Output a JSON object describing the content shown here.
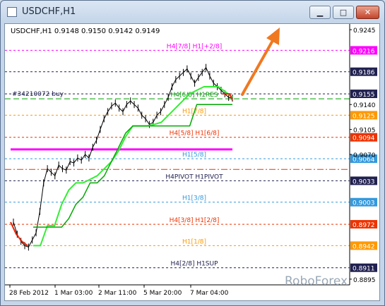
{
  "window": {
    "title": "USDCHF,H1",
    "min_icon": "minimize-icon",
    "max_icon": "maximize-icon",
    "close_icon": "close-icon",
    "min_label": "▁",
    "max_label": "□",
    "close_label": "✕"
  },
  "chart_info": {
    "header": "USDCHF,H1  0.9148 0.9150 0.9142 0.9149",
    "order_label": "#34210072 buy",
    "watermark": "RoboForex"
  },
  "chart_data": {
    "type": "line",
    "symbol": "USDCHF",
    "timeframe": "H1",
    "ylim": [
      0.8887,
      0.9253
    ],
    "x_ticks": [
      "28 Feb 2012",
      "1 Mar 03:00",
      "2 Mar 11:00",
      "5 Mar 20:00",
      "7 Mar 04:00"
    ],
    "y_ticks": [
      "0.9245",
      "0.9186",
      "0.9140",
      "0.9105",
      "0.9070",
      "0.9033",
      "0.8972",
      "0.8942",
      "0.8911",
      "0.8895"
    ],
    "levels": [
      {
        "label": "H4[7/8] H1[+2/8]",
        "value": 0.9216,
        "color": "#ff00ff",
        "dash": "3,3",
        "price": "0.9216"
      },
      {
        "label": "",
        "value": 0.9186,
        "color": "#202050",
        "dash": "3,3",
        "price": "0.9186"
      },
      {
        "label": "",
        "value": 0.9155,
        "color": "#202050",
        "dash": "3,3",
        "price": "0.9155"
      },
      {
        "label": "H4[6/8] H1RES",
        "value": 0.9148,
        "color": "#00a000",
        "dash": "8,4",
        "price": ""
      },
      {
        "label": "H1[7/8]",
        "value": 0.9125,
        "color": "#ff9900",
        "dash": "3,3",
        "price": "0.9125"
      },
      {
        "label": "H4[5/8] H1[6/8]",
        "value": 0.9094,
        "color": "#ee3300",
        "dash": "3,3",
        "price": "0.9094"
      },
      {
        "label": "H1[5/8]",
        "value": 0.9064,
        "color": "#3399dd",
        "dash": "3,3",
        "price": "0.9064"
      },
      {
        "label": "",
        "value": 0.9049,
        "color": "#ee3300",
        "dash": "9,3,2,3",
        "price": ""
      },
      {
        "label": "H4PIVOT H1PIVOT",
        "value": 0.9033,
        "color": "#202050",
        "dash": "3,3",
        "price": "0.9033"
      },
      {
        "label": "H1[3/8]",
        "value": 0.9003,
        "color": "#3399dd",
        "dash": "3,3",
        "price": "0.9003"
      },
      {
        "label": "H4[3/8] H1[2/8]",
        "value": 0.8972,
        "color": "#ee3300",
        "dash": "3,3",
        "price": "0.8972"
      },
      {
        "label": "H1[1/8]",
        "value": 0.8942,
        "color": "#ff9900",
        "dash": "3,3",
        "price": "0.8942"
      },
      {
        "label": "H4[2/8] H1SUP",
        "value": 0.8911,
        "color": "#202050",
        "dash": "3,3",
        "price": "0.8911"
      }
    ],
    "price_line": [
      0.8975,
      0.8958,
      0.8948,
      0.8942,
      0.894,
      0.895,
      0.896,
      0.899,
      0.903,
      0.905,
      0.9045,
      0.904,
      0.9055,
      0.905,
      0.9048,
      0.906,
      0.9058,
      0.9065,
      0.9062,
      0.907,
      0.9065,
      0.908,
      0.909,
      0.9105,
      0.912,
      0.913,
      0.9138,
      0.9142,
      0.9135,
      0.913,
      0.914,
      0.9145,
      0.914,
      0.9135,
      0.9125,
      0.912,
      0.9112,
      0.9115,
      0.9125,
      0.913,
      0.914,
      0.915,
      0.9165,
      0.9175,
      0.918,
      0.9185,
      0.919,
      0.918,
      0.917,
      0.9178,
      0.9185,
      0.9192,
      0.918,
      0.917,
      0.9165,
      0.916,
      0.9155,
      0.915,
      0.9149
    ],
    "red_line": [
      0.8975,
      0.8958,
      0.8948,
      0.8942
    ],
    "green_line": [
      0.8942,
      0.8942,
      0.897,
      0.897,
      0.9,
      0.902,
      0.903,
      0.903,
      0.9035,
      0.904,
      0.905,
      0.906,
      0.9075,
      0.9095,
      0.911,
      0.911,
      0.911,
      0.9112,
      0.9115,
      0.9125,
      0.9135,
      0.9145,
      0.9155,
      0.916,
      0.9165,
      0.9165,
      0.9165,
      0.9158,
      0.915
    ],
    "ma_line": [
      0.8968,
      0.8968,
      0.8968,
      0.8968,
      0.8968,
      0.898,
      0.9,
      0.901,
      0.903,
      0.903,
      0.904,
      0.906,
      0.908,
      0.91,
      0.911,
      0.911,
      0.911,
      0.911,
      0.911,
      0.911,
      0.911,
      0.911,
      0.911,
      0.914,
      0.914,
      0.914,
      0.914,
      0.914,
      0.914
    ],
    "last_price": "0.9149"
  }
}
